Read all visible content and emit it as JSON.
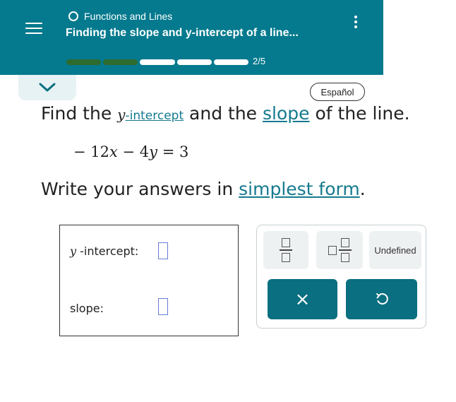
{
  "header": {
    "topic": "Functions and Lines",
    "title": "Finding the slope and y-intercept of a line...",
    "progress_text": "2/5",
    "progress": {
      "done": 2,
      "total": 5
    },
    "colors": {
      "header_bg": "#057a8e",
      "progress_done": "#2d6b2f",
      "accent": "#157a8e"
    }
  },
  "language_button": "Español",
  "question": {
    "find_pre": "Find the ",
    "y_var": "y",
    "y_intercept_link": "-intercept",
    "and_the": " and the ",
    "slope_link": "slope",
    "of_line": " of the line.",
    "equation": {
      "minus1": "− 12",
      "x": "x",
      "minus2": " − 4",
      "y": "y",
      "equals": " = 3"
    },
    "write_pre": "Write your answers in ",
    "simplest_link": "simplest form",
    "write_post": "."
  },
  "answer": {
    "y_var": "y",
    "y_intercept_label": " -intercept:",
    "slope_label": "slope:"
  },
  "keypad": {
    "undefined_label": "Undefined",
    "clear_symbol": "×",
    "undo_icon": "undo-icon"
  }
}
